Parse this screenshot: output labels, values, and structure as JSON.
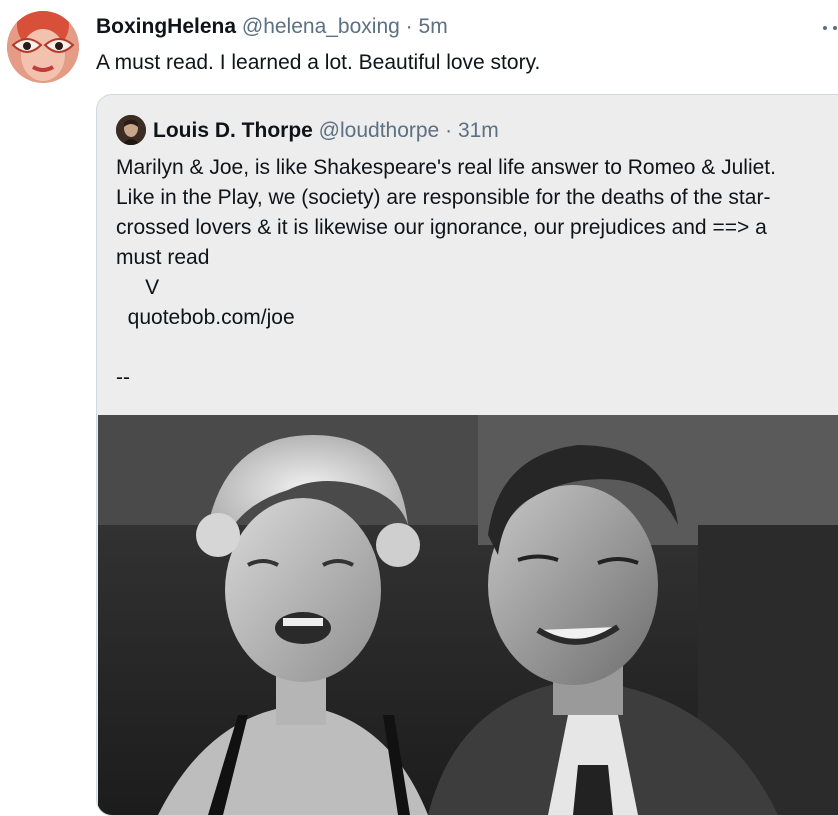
{
  "tweet": {
    "author_name": "BoxingHelena",
    "handle": "@helena_boxing",
    "separator": "·",
    "time": "5m",
    "more_icon": "ellipsis-icon",
    "text": "A must read. I learned a lot. Beautiful love story."
  },
  "quoted_tweet": {
    "author_name": "Louis D. Thorpe",
    "handle": "@loudthorpe",
    "separator": "·",
    "time": "31m",
    "lines": [
      "Marilyn & Joe, is like Shakespeare's real life answer to Romeo & Juliet.",
      "Like in the Play, we (society) are responsible for the deaths of the star-",
      "crossed lovers & it is likewise our ignorance, our prejudices and ==> a",
      "must read",
      "     V",
      "  quotebob.com/joe",
      " ",
      "--"
    ]
  },
  "colors": {
    "text": "#0f1419",
    "secondary": "#5b7083",
    "quote_bg": "#ededed",
    "quote_border": "#cfd9de"
  }
}
